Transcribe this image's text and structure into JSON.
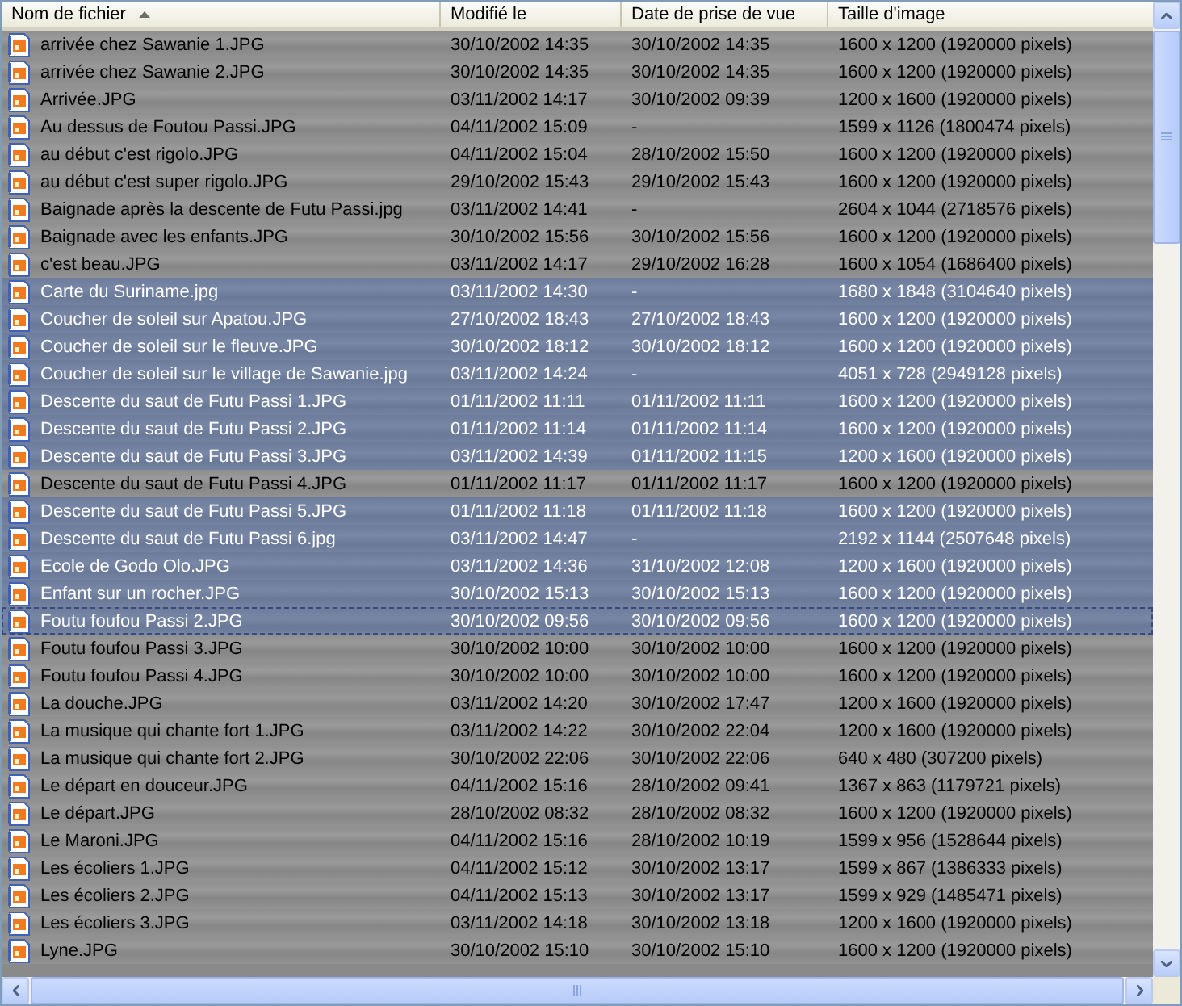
{
  "columns": [
    {
      "label": "Nom de fichier",
      "sorted": true
    },
    {
      "label": "Modifié le",
      "sorted": false
    },
    {
      "label": "Date de prise de vue",
      "sorted": false
    },
    {
      "label": "Taille d'image",
      "sorted": false
    }
  ],
  "rows": [
    {
      "name": "arrivée chez Sawanie 1.JPG",
      "modified": "30/10/2002 14:35",
      "taken": "30/10/2002 14:35",
      "size": "1600 x 1200 (1920000 pixels)",
      "selected": false,
      "focused": false
    },
    {
      "name": "arrivée chez Sawanie 2.JPG",
      "modified": "30/10/2002 14:35",
      "taken": "30/10/2002 14:35",
      "size": "1600 x 1200 (1920000 pixels)",
      "selected": false,
      "focused": false
    },
    {
      "name": "Arrivée.JPG",
      "modified": "03/11/2002 14:17",
      "taken": "30/10/2002 09:39",
      "size": "1200 x 1600 (1920000 pixels)",
      "selected": false,
      "focused": false
    },
    {
      "name": "Au dessus de Foutou Passi.JPG",
      "modified": "04/11/2002 15:09",
      "taken": "-",
      "size": "1599 x 1126 (1800474 pixels)",
      "selected": false,
      "focused": false
    },
    {
      "name": "au début c'est rigolo.JPG",
      "modified": "04/11/2002 15:04",
      "taken": "28/10/2002 15:50",
      "size": "1600 x 1200 (1920000 pixels)",
      "selected": false,
      "focused": false
    },
    {
      "name": "au début c'est super rigolo.JPG",
      "modified": "29/10/2002 15:43",
      "taken": "29/10/2002 15:43",
      "size": "1600 x 1200 (1920000 pixels)",
      "selected": false,
      "focused": false
    },
    {
      "name": "Baignade après la descente de Futu Passi.jpg",
      "modified": "03/11/2002 14:41",
      "taken": "-",
      "size": "2604 x 1044 (2718576 pixels)",
      "selected": false,
      "focused": false
    },
    {
      "name": "Baignade avec les enfants.JPG",
      "modified": "30/10/2002 15:56",
      "taken": "30/10/2002 15:56",
      "size": "1600 x 1200 (1920000 pixels)",
      "selected": false,
      "focused": false
    },
    {
      "name": "c'est beau.JPG",
      "modified": "03/11/2002 14:17",
      "taken": "29/10/2002 16:28",
      "size": "1600 x 1054 (1686400 pixels)",
      "selected": false,
      "focused": false
    },
    {
      "name": "Carte du Suriname.jpg",
      "modified": "03/11/2002 14:30",
      "taken": "-",
      "size": "1680 x 1848 (3104640 pixels)",
      "selected": true,
      "focused": false
    },
    {
      "name": "Coucher de soleil sur Apatou.JPG",
      "modified": "27/10/2002 18:43",
      "taken": "27/10/2002 18:43",
      "size": "1600 x 1200 (1920000 pixels)",
      "selected": true,
      "focused": false
    },
    {
      "name": "Coucher de soleil sur le fleuve.JPG",
      "modified": "30/10/2002 18:12",
      "taken": "30/10/2002 18:12",
      "size": "1600 x 1200 (1920000 pixels)",
      "selected": true,
      "focused": false
    },
    {
      "name": "Coucher de soleil sur le village de Sawanie.jpg",
      "modified": "03/11/2002 14:24",
      "taken": "-",
      "size": "4051 x 728 (2949128 pixels)",
      "selected": true,
      "focused": false
    },
    {
      "name": "Descente du saut de Futu Passi 1.JPG",
      "modified": "01/11/2002 11:11",
      "taken": "01/11/2002 11:11",
      "size": "1600 x 1200 (1920000 pixels)",
      "selected": true,
      "focused": false
    },
    {
      "name": "Descente du saut de Futu Passi 2.JPG",
      "modified": "01/11/2002 11:14",
      "taken": "01/11/2002 11:14",
      "size": "1600 x 1200 (1920000 pixels)",
      "selected": true,
      "focused": false
    },
    {
      "name": "Descente du saut de Futu Passi 3.JPG",
      "modified": "03/11/2002 14:39",
      "taken": "01/11/2002 11:15",
      "size": "1200 x 1600 (1920000 pixels)",
      "selected": true,
      "focused": false
    },
    {
      "name": "Descente du saut de Futu Passi 4.JPG",
      "modified": "01/11/2002 11:17",
      "taken": "01/11/2002 11:17",
      "size": "1600 x 1200 (1920000 pixels)",
      "selected": false,
      "focused": false
    },
    {
      "name": "Descente du saut de Futu Passi 5.JPG",
      "modified": "01/11/2002 11:18",
      "taken": "01/11/2002 11:18",
      "size": "1600 x 1200 (1920000 pixels)",
      "selected": true,
      "focused": false
    },
    {
      "name": "Descente du saut de Futu Passi 6.jpg",
      "modified": "03/11/2002 14:47",
      "taken": "-",
      "size": "2192 x 1144 (2507648 pixels)",
      "selected": true,
      "focused": false
    },
    {
      "name": "Ecole de Godo Olo.JPG",
      "modified": "03/11/2002 14:36",
      "taken": "31/10/2002 12:08",
      "size": "1200 x 1600 (1920000 pixels)",
      "selected": true,
      "focused": false
    },
    {
      "name": "Enfant sur un rocher.JPG",
      "modified": "30/10/2002 15:13",
      "taken": "30/10/2002 15:13",
      "size": "1600 x 1200 (1920000 pixels)",
      "selected": true,
      "focused": false
    },
    {
      "name": "Foutu foufou Passi 2.JPG",
      "modified": "30/10/2002 09:56",
      "taken": "30/10/2002 09:56",
      "size": "1600 x 1200 (1920000 pixels)",
      "selected": true,
      "focused": true
    },
    {
      "name": "Foutu foufou Passi 3.JPG",
      "modified": "30/10/2002 10:00",
      "taken": "30/10/2002 10:00",
      "size": "1600 x 1200 (1920000 pixels)",
      "selected": false,
      "focused": false
    },
    {
      "name": "Foutu foufou Passi 4.JPG",
      "modified": "30/10/2002 10:00",
      "taken": "30/10/2002 10:00",
      "size": "1600 x 1200 (1920000 pixels)",
      "selected": false,
      "focused": false
    },
    {
      "name": "La douche.JPG",
      "modified": "03/11/2002 14:20",
      "taken": "30/10/2002 17:47",
      "size": "1200 x 1600 (1920000 pixels)",
      "selected": false,
      "focused": false
    },
    {
      "name": "La musique qui chante fort 1.JPG",
      "modified": "03/11/2002 14:22",
      "taken": "30/10/2002 22:04",
      "size": "1200 x 1600 (1920000 pixels)",
      "selected": false,
      "focused": false
    },
    {
      "name": "La musique qui chante fort 2.JPG",
      "modified": "30/10/2002 22:06",
      "taken": "30/10/2002 22:06",
      "size": "640 x 480 (307200 pixels)",
      "selected": false,
      "focused": false
    },
    {
      "name": "Le départ en douceur.JPG",
      "modified": "04/11/2002 15:16",
      "taken": "28/10/2002 09:41",
      "size": "1367 x 863 (1179721 pixels)",
      "selected": false,
      "focused": false
    },
    {
      "name": "Le départ.JPG",
      "modified": "28/10/2002 08:32",
      "taken": "28/10/2002 08:32",
      "size": "1600 x 1200 (1920000 pixels)",
      "selected": false,
      "focused": false
    },
    {
      "name": "Le Maroni.JPG",
      "modified": "04/11/2002 15:16",
      "taken": "28/10/2002 10:19",
      "size": "1599 x 956 (1528644 pixels)",
      "selected": false,
      "focused": false
    },
    {
      "name": "Les écoliers 1.JPG",
      "modified": "04/11/2002 15:12",
      "taken": "30/10/2002 13:17",
      "size": "1599 x 867 (1386333 pixels)",
      "selected": false,
      "focused": false
    },
    {
      "name": "Les écoliers 2.JPG",
      "modified": "04/11/2002 15:13",
      "taken": "30/10/2002 13:17",
      "size": "1599 x 929 (1485471 pixels)",
      "selected": false,
      "focused": false
    },
    {
      "name": "Les écoliers 3.JPG",
      "modified": "03/11/2002 14:18",
      "taken": "30/10/2002 13:18",
      "size": "1200 x 1600 (1920000 pixels)",
      "selected": false,
      "focused": false
    },
    {
      "name": "Lyne.JPG",
      "modified": "30/10/2002 15:10",
      "taken": "30/10/2002 15:10",
      "size": "1600 x 1200 (1920000 pixels)",
      "selected": false,
      "focused": false
    }
  ]
}
